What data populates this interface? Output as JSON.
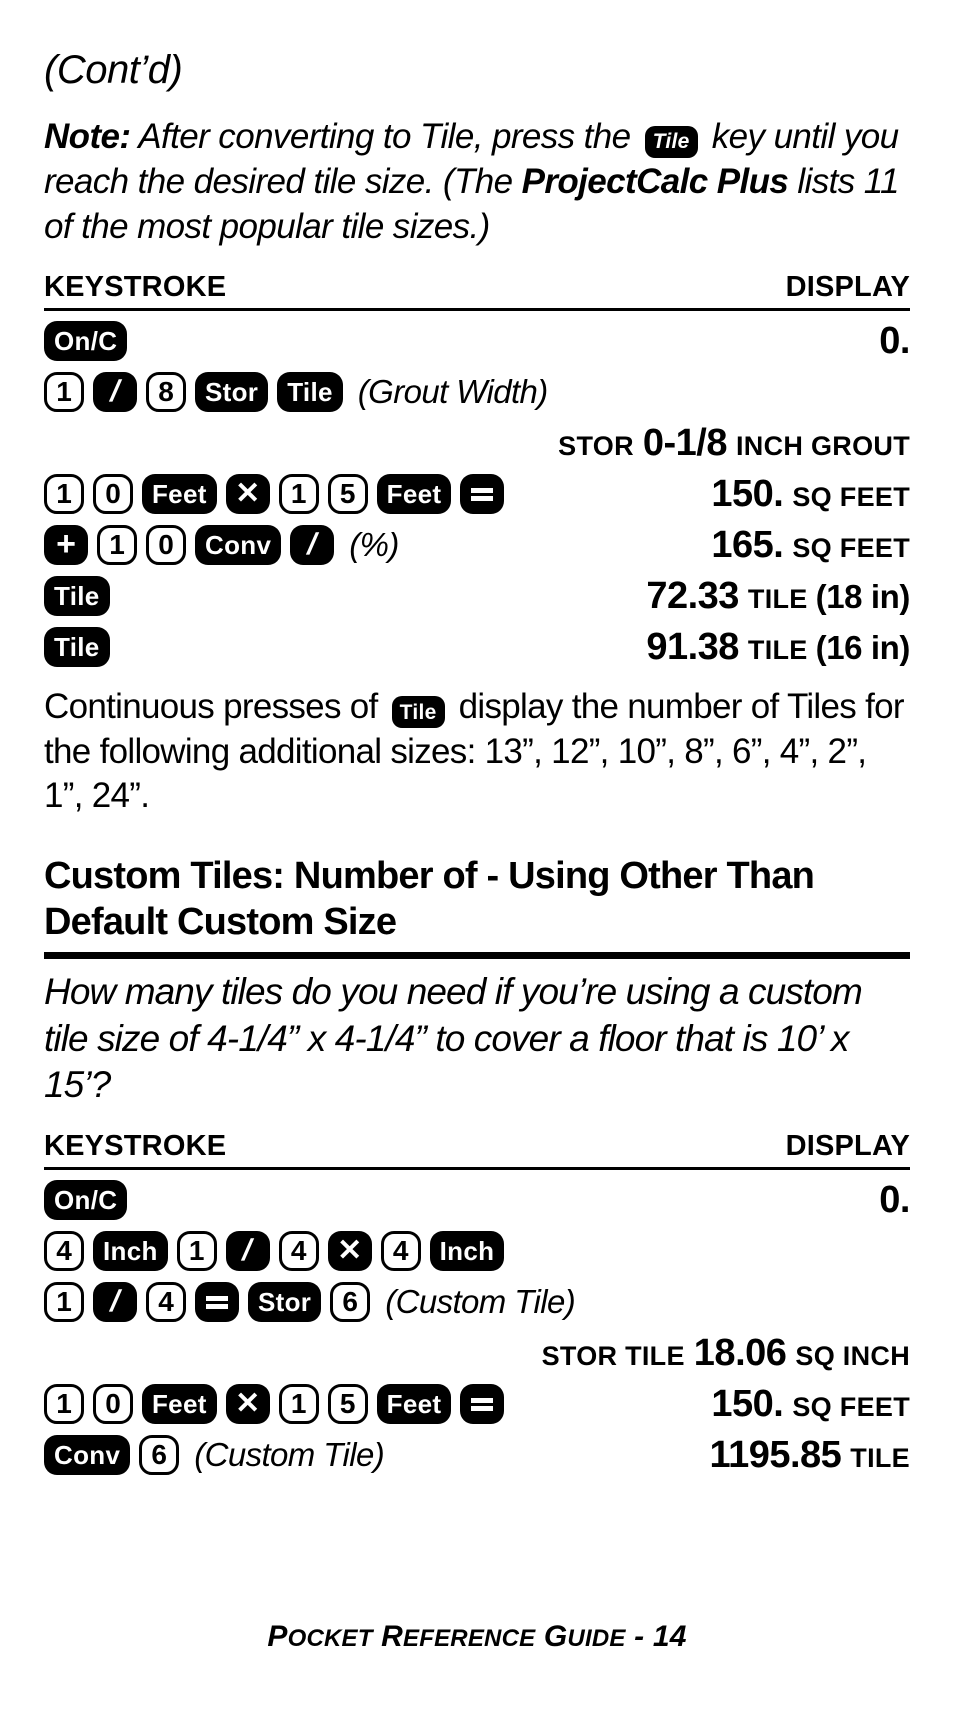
{
  "cont_heading": "(Cont’d)",
  "note": {
    "bold_prefix": "Note:",
    "text_1": " After converting to Tile, press the ",
    "key_tile": "Tile",
    "text_2": " key until you reach the desired tile size. (The ",
    "bold_product": "ProjectCalc Plus",
    "text_3": " lists 11 of the most popular tile sizes.)"
  },
  "table_headers": {
    "keystroke": "KEYSTROKE",
    "display": "DISPLAY"
  },
  "table1": {
    "rows": [
      {
        "keys": [
          {
            "t": "fn",
            "label": "On/C"
          }
        ],
        "note": "",
        "display": {
          "prefix": "",
          "value": "0.",
          "suffix": "",
          "after": ""
        }
      },
      {
        "keys": [
          {
            "t": "num",
            "label": "1"
          },
          {
            "t": "op",
            "label": "/"
          },
          {
            "t": "num",
            "label": "8"
          },
          {
            "t": "fn",
            "label": "Stor"
          },
          {
            "t": "fn",
            "label": "Tile"
          }
        ],
        "note": "(Grout Width)",
        "display": {
          "prefix": "",
          "value": "",
          "suffix": "",
          "after": ""
        }
      },
      {
        "keys": [],
        "note": "",
        "display": {
          "prefix": "STOR",
          "value": "0-1/8",
          "suffix": "INCH GROUT",
          "after": ""
        }
      },
      {
        "keys": [
          {
            "t": "num",
            "label": "1"
          },
          {
            "t": "num",
            "label": "0"
          },
          {
            "t": "fn",
            "label": "Feet"
          },
          {
            "t": "op",
            "label": "x"
          },
          {
            "t": "num",
            "label": "1"
          },
          {
            "t": "num",
            "label": "5"
          },
          {
            "t": "fn",
            "label": "Feet"
          },
          {
            "t": "op",
            "label": "="
          }
        ],
        "note": "",
        "display": {
          "prefix": "",
          "value": "150.",
          "suffix": "SQ FEET",
          "after": ""
        }
      },
      {
        "keys": [
          {
            "t": "op",
            "label": "+"
          },
          {
            "t": "num",
            "label": "1"
          },
          {
            "t": "num",
            "label": "0"
          },
          {
            "t": "fn",
            "label": "Conv"
          },
          {
            "t": "op",
            "label": "/"
          }
        ],
        "note": "(%)",
        "display": {
          "prefix": "",
          "value": "165.",
          "suffix": "SQ FEET",
          "after": ""
        }
      },
      {
        "keys": [
          {
            "t": "fn",
            "label": "Tile"
          }
        ],
        "note": "",
        "display": {
          "prefix": "",
          "value": "72.33",
          "suffix": "TILE",
          "after": "(18 in)"
        }
      },
      {
        "keys": [
          {
            "t": "fn",
            "label": "Tile"
          }
        ],
        "note": "",
        "display": {
          "prefix": "",
          "value": "91.38",
          "suffix": "TILE",
          "after": "(16 in)"
        }
      }
    ]
  },
  "continuous": {
    "text_1": "Continuous presses of ",
    "key_tile": "Tile",
    "text_2": " display the number of Tiles for the following additional sizes: 13”, 12”, 10”, 8”, 6”, 4”, 2”, 1”, 24”."
  },
  "section_title": "Custom Tiles: Number of - Using Other Than Default Custom Size",
  "question": "How many tiles do you need if you’re using a custom tile size of 4-1/4” x 4-1/4” to cover a floor that is 10’ x 15’?",
  "table2": {
    "rows": [
      {
        "keys": [
          {
            "t": "fn",
            "label": "On/C"
          }
        ],
        "note": "",
        "display": {
          "prefix": "",
          "value": "0.",
          "suffix": "",
          "after": ""
        }
      },
      {
        "keys": [
          {
            "t": "num",
            "label": "4"
          },
          {
            "t": "fn",
            "label": "Inch"
          },
          {
            "t": "num",
            "label": "1"
          },
          {
            "t": "op",
            "label": "/"
          },
          {
            "t": "num",
            "label": "4"
          },
          {
            "t": "op",
            "label": "x"
          },
          {
            "t": "num",
            "label": "4"
          },
          {
            "t": "fn",
            "label": "Inch"
          }
        ],
        "note": "",
        "display": {
          "prefix": "",
          "value": "",
          "suffix": "",
          "after": ""
        }
      },
      {
        "keys": [
          {
            "t": "num",
            "label": "1"
          },
          {
            "t": "op",
            "label": "/"
          },
          {
            "t": "num",
            "label": "4"
          },
          {
            "t": "op",
            "label": "="
          },
          {
            "t": "fn",
            "label": "Stor"
          },
          {
            "t": "num",
            "label": "6"
          }
        ],
        "note": "(Custom Tile)",
        "display": {
          "prefix": "",
          "value": "",
          "suffix": "",
          "after": ""
        }
      },
      {
        "keys": [],
        "note": "",
        "display": {
          "prefix": "STOR TILE",
          "value": "18.06",
          "suffix": "SQ INCH",
          "after": ""
        }
      },
      {
        "keys": [
          {
            "t": "num",
            "label": "1"
          },
          {
            "t": "num",
            "label": "0"
          },
          {
            "t": "fn",
            "label": "Feet"
          },
          {
            "t": "op",
            "label": "x"
          },
          {
            "t": "num",
            "label": "1"
          },
          {
            "t": "num",
            "label": "5"
          },
          {
            "t": "fn",
            "label": "Feet"
          },
          {
            "t": "op",
            "label": "="
          }
        ],
        "note": "",
        "display": {
          "prefix": "",
          "value": "150.",
          "suffix": "SQ FEET",
          "after": ""
        }
      },
      {
        "keys": [
          {
            "t": "fn",
            "label": "Conv"
          },
          {
            "t": "num",
            "label": "6"
          }
        ],
        "note": "(Custom Tile)",
        "display": {
          "prefix": "",
          "value": "1195.85",
          "suffix": "TILE",
          "after": ""
        }
      }
    ]
  },
  "footer": {
    "p": "P",
    "ocket": "OCKET",
    "r": "R",
    "eference": "EFERENCE",
    "g": "G",
    "uide": "UIDE",
    "dash_page": " - 14"
  },
  "colors": {
    "ink": "#000000",
    "paper": "#ffffff"
  }
}
